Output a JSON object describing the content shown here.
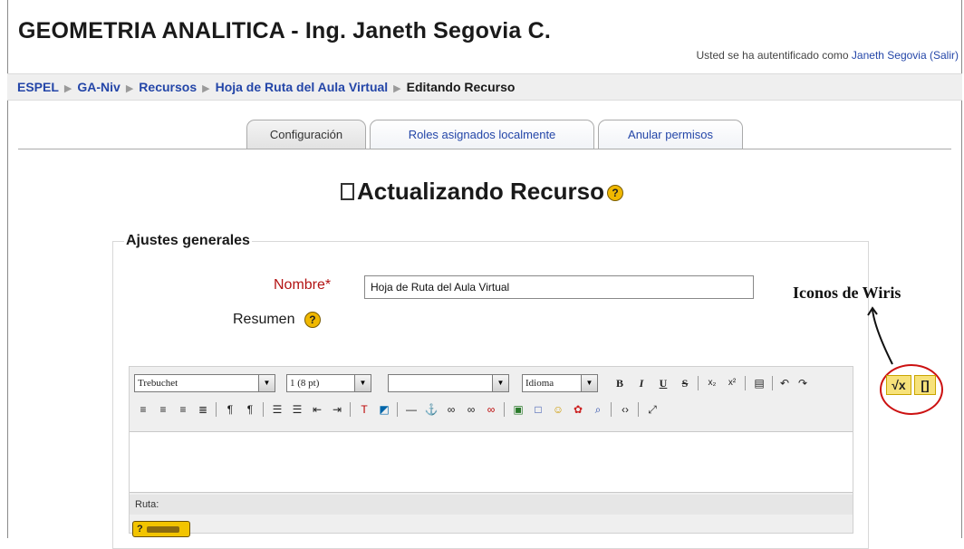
{
  "header": {
    "title": "GEOMETRIA ANALITICA - Ing. Janeth Segovia C.",
    "login_prefix": "Usted se ha autentificado como",
    "user_name": "Janeth Segovia",
    "logout_label": "(Salir)"
  },
  "breadcrumb": {
    "items": [
      "ESPEL",
      "GA-Niv",
      "Recursos",
      "Hoja de Ruta del Aula Virtual"
    ],
    "current": "Editando Recurso"
  },
  "tabs": [
    {
      "label": "Configuración",
      "active": true
    },
    {
      "label": "Roles asignados localmente",
      "active": false
    },
    {
      "label": "Anular permisos",
      "active": false
    }
  ],
  "page": {
    "heading": "Actualizando Recurso",
    "help_glyph": "?"
  },
  "form": {
    "legend": "Ajustes generales",
    "name_label": "Nombre*",
    "name_value": "Hoja de Ruta del Aula Virtual",
    "summary_label": "Resumen"
  },
  "editor": {
    "font_family": "Trebuchet",
    "font_size": "1 (8 pt)",
    "format": "",
    "language": "Idioma",
    "path_label": "Ruta:",
    "help_key_label": "?"
  },
  "annotation": {
    "wiris_label": "Iconos de Wiris",
    "wiris_formula_glyph": "√x",
    "wiris_cas_glyph": "[]"
  },
  "colors": {
    "link": "#2446a8",
    "required": "#b31313",
    "highlight_circle": "#cc1111",
    "toolbar_bg": "#efefef"
  }
}
